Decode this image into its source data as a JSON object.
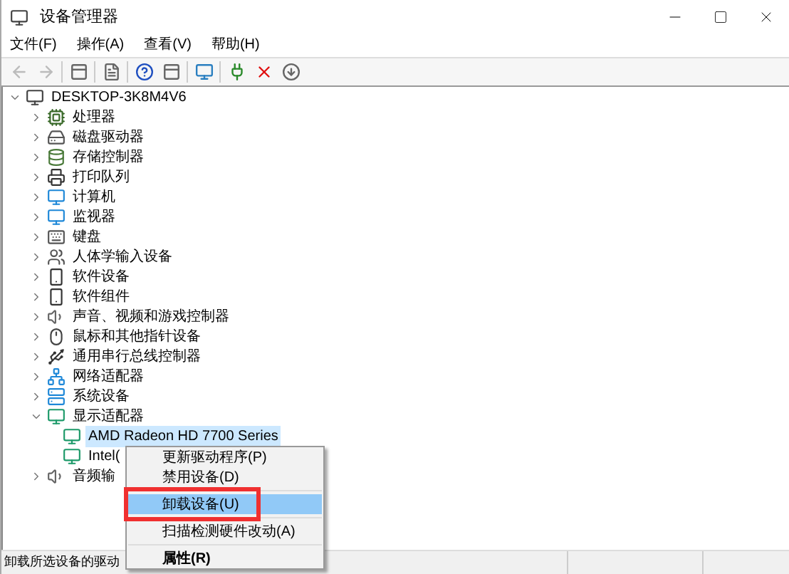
{
  "window": {
    "title": "设备管理器"
  },
  "menu_bar": [
    "文件(F)",
    "操作(A)",
    "查看(V)",
    "帮助(H)"
  ],
  "toolbar": [
    {
      "kind": "back",
      "disabled": true
    },
    {
      "kind": "forward",
      "disabled": true
    },
    {
      "kind": "sep"
    },
    {
      "kind": "panel",
      "disabled": false
    },
    {
      "kind": "sep"
    },
    {
      "kind": "properties",
      "disabled": false
    },
    {
      "kind": "sep"
    },
    {
      "kind": "help",
      "disabled": false
    },
    {
      "kind": "panel",
      "disabled": false
    },
    {
      "kind": "sep"
    },
    {
      "kind": "monitor",
      "disabled": false
    },
    {
      "kind": "sep"
    },
    {
      "kind": "plug",
      "disabled": false
    },
    {
      "kind": "remove",
      "disabled": false
    },
    {
      "kind": "download",
      "disabled": false
    }
  ],
  "tree": {
    "label": "DESKTOP-3K8M4V6",
    "expanded": true,
    "children": [
      {
        "label": "处理器",
        "kind": "cpu",
        "expanded": false
      },
      {
        "label": "磁盘驱动器",
        "kind": "disk",
        "expanded": false
      },
      {
        "label": "存储控制器",
        "kind": "storage",
        "expanded": false
      },
      {
        "label": "打印队列",
        "kind": "printer",
        "expanded": false
      },
      {
        "label": "计算机",
        "kind": "monitor",
        "expanded": false
      },
      {
        "label": "监视器",
        "kind": "monitor",
        "expanded": false
      },
      {
        "label": "键盘",
        "kind": "keyboard",
        "expanded": false
      },
      {
        "label": "人体学输入设备",
        "kind": "hid",
        "expanded": false
      },
      {
        "label": "软件设备",
        "kind": "phone",
        "expanded": false
      },
      {
        "label": "软件组件",
        "kind": "phone",
        "expanded": false
      },
      {
        "label": "声音、视频和游戏控制器",
        "kind": "speaker",
        "expanded": false
      },
      {
        "label": "鼠标和其他指针设备",
        "kind": "mouse",
        "expanded": false
      },
      {
        "label": "通用串行总线控制器",
        "kind": "usb",
        "expanded": false
      },
      {
        "label": "网络适配器",
        "kind": "network",
        "expanded": false
      },
      {
        "label": "系统设备",
        "kind": "system",
        "expanded": false
      },
      {
        "label": "显示适配器",
        "kind": "display",
        "expanded": true,
        "children": [
          {
            "label": "AMD Radeon HD 7700 Series",
            "kind": "display",
            "selected": true
          },
          {
            "label": "Intel(",
            "kind": "display",
            "selected": false
          }
        ]
      },
      {
        "label": "音频输",
        "kind": "speaker",
        "expanded": false
      }
    ]
  },
  "context_menu": [
    {
      "label": "更新驱动程序(P)",
      "bold": false,
      "highlighted": false
    },
    {
      "label": "禁用设备(D)",
      "bold": false,
      "highlighted": false
    },
    {
      "kind": "sep"
    },
    {
      "label": "卸载设备(U)",
      "bold": false,
      "highlighted": true
    },
    {
      "kind": "sep"
    },
    {
      "label": "扫描检测硬件改动(A)",
      "bold": false,
      "highlighted": false
    },
    {
      "kind": "sep"
    },
    {
      "label": "属性(R)",
      "bold": true,
      "highlighted": false
    }
  ],
  "status_bar": {
    "text": "卸载所选设备的驱动"
  }
}
